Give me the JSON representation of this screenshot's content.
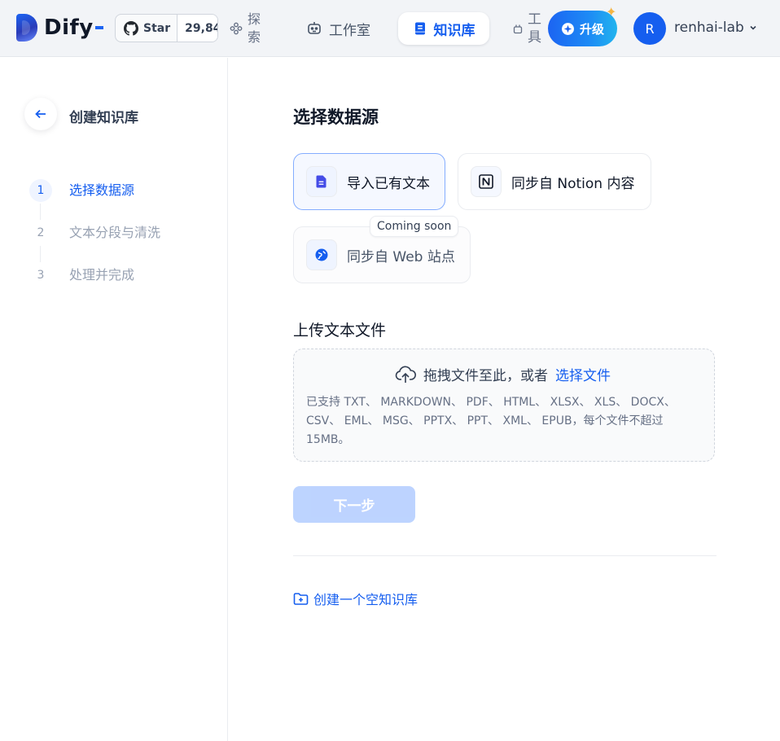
{
  "brand": {
    "name": "Dify"
  },
  "github": {
    "star_label": "Star",
    "star_count": "29,84"
  },
  "nav": {
    "explore": "探索",
    "studio": "工作室",
    "datasets": "知识库",
    "tools": "工具"
  },
  "upgrade": {
    "label": "升级"
  },
  "user": {
    "initial": "R",
    "name": "renhai-lab"
  },
  "sidebar": {
    "title": "创建知识库",
    "steps": [
      {
        "num": "1",
        "label": "选择数据源",
        "active": true
      },
      {
        "num": "2",
        "label": "文本分段与清洗",
        "active": false
      },
      {
        "num": "3",
        "label": "处理并完成",
        "active": false
      }
    ]
  },
  "main": {
    "title": "选择数据源",
    "sources": {
      "file": "导入已有文本",
      "notion": "同步自 Notion 内容",
      "web": "同步自 Web 站点",
      "coming_soon": "Coming soon"
    },
    "upload": {
      "title": "上传文本文件",
      "drop_text": "拖拽文件至此，或者",
      "drop_link": "选择文件",
      "tip": "已支持 TXT、 MARKDOWN、 PDF、 HTML、 XLSX、 XLS、 DOCX、 CSV、 EML、 MSG、 PPTX、 PPT、 XML、 EPUB，每个文件不超过 15MB。"
    },
    "next_button": "下一步",
    "empty_kb": "创建一个空知识库"
  },
  "colors": {
    "primary": "#155eef",
    "topbar_bg": "#f2f4f7",
    "selected_border": "#84adff",
    "next_disabled": "#b2ccff"
  }
}
